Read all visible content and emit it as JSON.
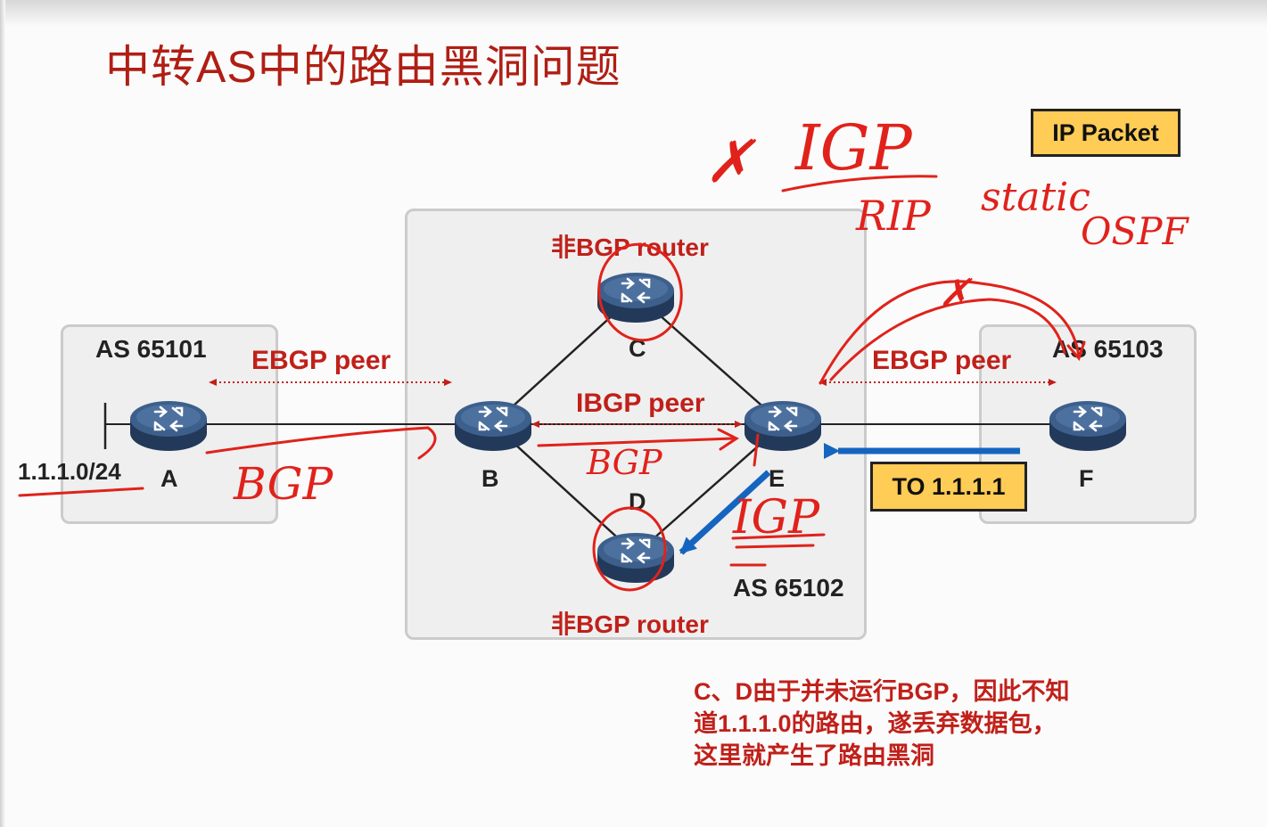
{
  "title": "中转AS中的路由黑洞问题",
  "legend": {
    "ip_packet": "IP Packet"
  },
  "as_boxes": {
    "left": "AS 65101",
    "middle": "AS 65102",
    "right": "AS 65103"
  },
  "routers": {
    "A": "A",
    "B": "B",
    "C": "C",
    "D": "D",
    "E": "E",
    "F": "F"
  },
  "labels": {
    "network": "1.1.1.0/24",
    "ebgp_left": "EBGP peer",
    "ebgp_right": "EBGP peer",
    "ibgp": "IBGP peer",
    "non_bgp_top": "非BGP router",
    "non_bgp_bottom": "非BGP router",
    "to_dest": "TO 1.1.1.1"
  },
  "note_lines": [
    "C、D由于并未运行BGP，因此不知",
    "道1.1.1.0的路由，遂丢弃数据包，",
    "这里就产生了路由黑洞"
  ],
  "annotations": {
    "x_mark": "✗",
    "igp_top": "IGP",
    "rip": "RIP",
    "static": "static",
    "ospf": "OSPF",
    "bgp_left": "BGP",
    "bgp_mid": "BGP",
    "igp_mid": "IGP"
  },
  "colors": {
    "title_red": "#b01e14",
    "label_red": "#c0201a",
    "handwriting_red": "#e0221b",
    "arrow_blue": "#1565c0",
    "highlight_yellow": "#ffcc55",
    "router_blue": "#3d5f8c",
    "as_box_fill": "#efefef"
  },
  "icons": {
    "router": "router-icon",
    "arrow": "blue-arrow-icon"
  }
}
